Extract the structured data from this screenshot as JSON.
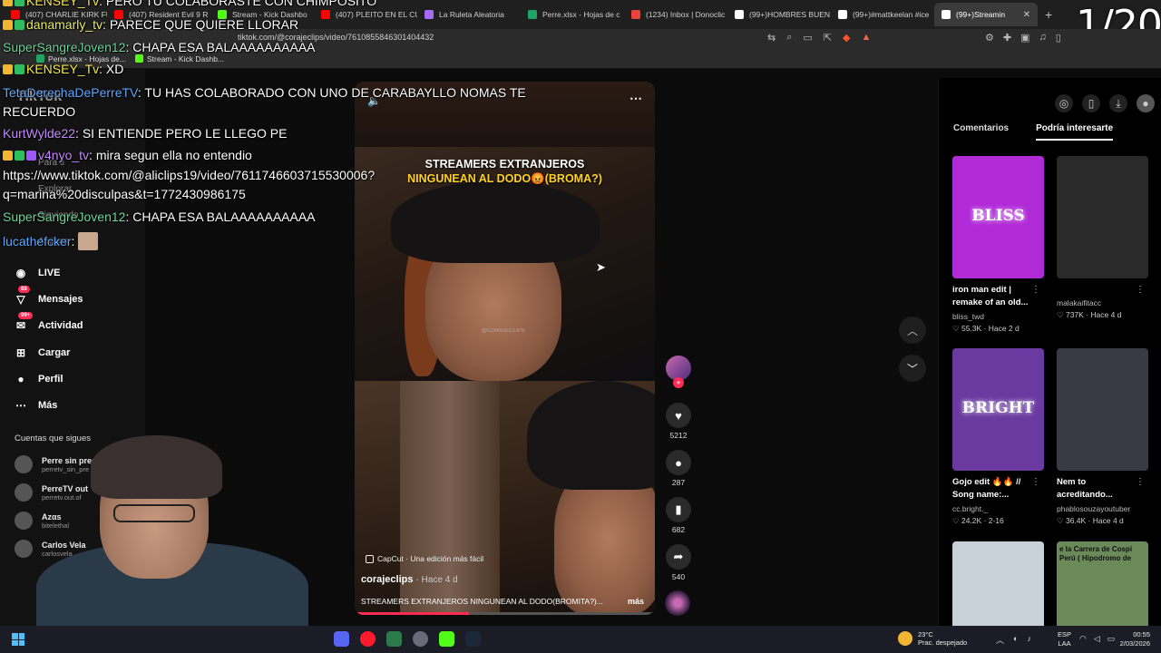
{
  "browser": {
    "tabs": [
      {
        "label": "(407) CHARLIE KIRK FU",
        "color": "#ff0000"
      },
      {
        "label": "(407) Resident Evil 9 R",
        "color": "#ff0000"
      },
      {
        "label": "Stream - Kick Dashbo",
        "color": "#53fc18"
      },
      {
        "label": "(407) PLEITO EN EL CU",
        "color": "#ff0000"
      },
      {
        "label": "La Ruleta Aleatoria",
        "color": "#a66cff"
      },
      {
        "label": "Perre.xlsx - Hojas de c",
        "color": "#1fa463"
      },
      {
        "label": "(1234) Inbox | Donoclic",
        "color": "#ea4335"
      },
      {
        "label": "(99+)HOMBRES BUEN",
        "color": "#ffffff"
      },
      {
        "label": "(99+)#mattkeelan #ice",
        "color": "#ffffff"
      },
      {
        "label": "(99+)Streamin",
        "color": "#ffffff",
        "active": true
      }
    ],
    "url": "tiktok.com/@corajeclips/video/7610855846301404432",
    "bookmarks": [
      {
        "label": "Perre.xlsx - Hojas de...",
        "color": "#1fa463"
      },
      {
        "label": "Stream - Kick Dashb...",
        "color": "#53fc18"
      }
    ]
  },
  "counter": "1/20",
  "tiktok": {
    "logo": "TikTok",
    "ghost_nav": [
      "Para ti",
      "Explorar",
      "Siguiendo",
      "Amigos"
    ],
    "nav": [
      {
        "label": "LIVE",
        "icon": "live-icon",
        "badge": ""
      },
      {
        "label": "Mensajes",
        "icon": "messages-icon",
        "badge": "88"
      },
      {
        "label": "Actividad",
        "icon": "activity-icon",
        "badge": "99+"
      },
      {
        "label": "Cargar",
        "icon": "upload-icon",
        "badge": ""
      },
      {
        "label": "Perfil",
        "icon": "profile-icon",
        "badge": ""
      },
      {
        "label": "Más",
        "icon": "more-icon",
        "badge": ""
      }
    ],
    "following_title": "Cuentas que sigues",
    "following": [
      {
        "name": "Perre sin pres",
        "handle": "perretv_sin_pre"
      },
      {
        "name": "PerreTV out",
        "handle": "perretv.out.of"
      },
      {
        "name": "Azαs",
        "handle": "bitelethal"
      },
      {
        "name": "Carlos Vela",
        "handle": "carlosvela"
      }
    ],
    "video": {
      "title_line1": "STREAMERS EXTRANJEROS",
      "title_line2": "NINGUNEAN AL DODO😡(BROMA?)",
      "watermark": "@CORAJECLIPS",
      "capcut": "CapCut · Una edición más fácil",
      "author": "corajeclips",
      "age": "· Hace 4 d",
      "caption": "STREAMERS EXTRANJEROS NINGUNEAN AL DODO(BROMITA?)...",
      "more": "más",
      "progress": 0.38
    },
    "actions": [
      {
        "icon": "heart-icon",
        "glyph": "♥",
        "count": "5212"
      },
      {
        "icon": "comment-icon",
        "glyph": "●",
        "count": "287"
      },
      {
        "icon": "bookmark-icon",
        "glyph": "▮",
        "count": "682"
      },
      {
        "icon": "share-icon",
        "glyph": "➦",
        "count": "540"
      }
    ],
    "right": {
      "tabs": [
        "Comentarios",
        "Podría interesarte"
      ],
      "cards": [
        {
          "title": "iron man edit | remake of an old...",
          "author": "bliss_twd",
          "stats": "♡ 55.3K · Hace 2 d",
          "thumb_color": "#b12ad8",
          "thumb_text": "BLISS"
        },
        {
          "title": "",
          "author": "malakaifitacc",
          "stats": "♡ 737K · Hace 4 d",
          "thumb_color": "#2a2a2a",
          "thumb_text": ""
        },
        {
          "title": "Gojo edit 🔥🔥 // Song name:...",
          "author": "cc.bright._",
          "stats": "♡ 24.2K · 2-16",
          "thumb_color": "#6a3aa0",
          "thumb_text": "BRIGHT"
        },
        {
          "title": "Nem to acreditando...",
          "author": "phablosouzayoutuber",
          "stats": "♡ 36.4K · Hace 4 d",
          "thumb_color": "#3a3a44",
          "thumb_text": ""
        },
        {
          "title": "",
          "author": "",
          "stats": "",
          "thumb_color": "#c8d0d8",
          "thumb_text": ""
        },
        {
          "title": "",
          "author": "",
          "stats": "",
          "thumb_color": "#6a8a5a",
          "thumb_text": "e la Carrera de Cospi Perú ( Hipodromo de"
        }
      ]
    }
  },
  "chat": [
    {
      "user": "KENSEY_Tv",
      "color": "#f7e94a",
      "text": "PERO TU COLABORASTE CON CHIMPOSITO",
      "badges": 2
    },
    {
      "user": "danamarly_tv",
      "color": "#e8ec6a",
      "text": "PARECE QUE QUIERE LLORAR",
      "badges": 2
    },
    {
      "user": "SuperSangreJoven12",
      "color": "#6fd69e",
      "text": "CHAPA ESA BALAAAAAAAAAA",
      "badges": 0
    },
    {
      "user": "KENSEY_Tv",
      "color": "#f7e94a",
      "text": "XD",
      "badges": 2
    },
    {
      "user": "TetaDerechaDePerreTV",
      "color": "#5ea8ff",
      "text": "TU HAS COLABORADO CON UNO DE CARABAYLLO NOMAS TE",
      "badges": 0
    },
    {
      "user": "",
      "color": "#ffffff",
      "text": "RECUERDO",
      "badges": 0
    },
    {
      "user": "KurtWylde22",
      "color": "#c58aff",
      "text": "SI ENTIENDE PERO LE LLEGO PE",
      "badges": 0
    },
    {
      "user": "v4nyo_tv",
      "color": "#c58aff",
      "text": "mira segun ella no entendio",
      "badges": 3
    },
    {
      "user": "",
      "color": "#ffffff",
      "text": "https://www.tiktok.com/@aliclips19/video/7611746603715530006?",
      "badges": 0
    },
    {
      "user": "",
      "color": "#ffffff",
      "text": "q=marina%20disculpas&t=1772430986175",
      "badges": 0
    },
    {
      "user": "SuperSangreJoven12",
      "color": "#6fd69e",
      "text": "CHAPA ESA BALAAAAAAAAAA",
      "badges": 0
    },
    {
      "user": "lucathefcker",
      "color": "#5ea8ff",
      "text": "",
      "badges": 0
    }
  ],
  "taskbar": {
    "weather_temp": "23°C",
    "weather_desc": "Prac. despejado",
    "lang1": "ESP",
    "lang2": "LAA",
    "time": "00:55",
    "date": "2/03/2026"
  }
}
